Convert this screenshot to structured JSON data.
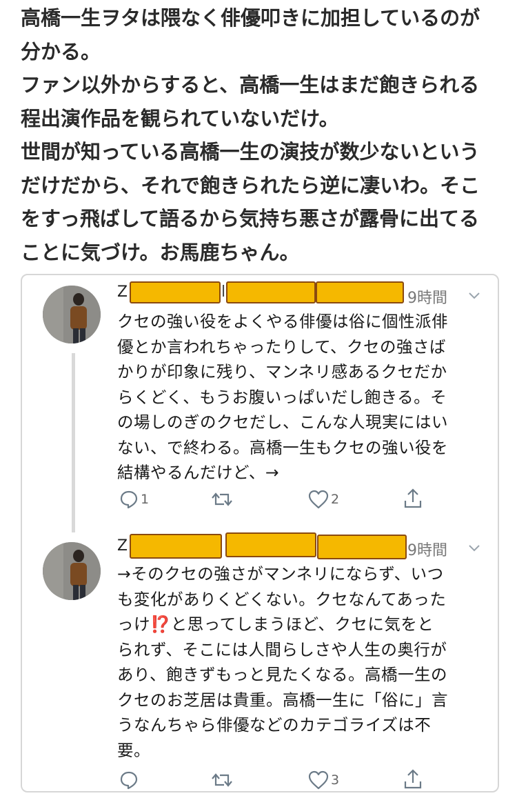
{
  "header": {
    "lines": [
      "高橋一生ヲタは隈なく俳優叩きに加担しているのが",
      "分かる。",
      "ファン以外からすると、高橋一生はまだ飽きられる",
      "程出演作品を観られていないだけ。",
      "世間が知っている高橋一生の演技が数少ないという",
      "だけだから、それで飽きられたら逆に凄いわ。そこ",
      "をすっ飛ばして語るから気持ち悪さが露骨に出てる",
      "ことに気づけ。お馬鹿ちゃん。"
    ]
  },
  "tweets": [
    {
      "name_initial": "Z",
      "name_sep": "l",
      "time": "9時間",
      "body_lines": [
        "クセの強い役をよくやる俳優は俗に個性派俳",
        "優とか言われちゃったりして、クセの強さば",
        "かりが印象に残り、マンネリ感あるクセだか",
        "らくどく、もうお腹いっぱいだし飽きる。そ",
        "の場しのぎのクセだし、こんな人現実にはい",
        "ない、で終わる。高橋一生もクセの強い役を",
        "結構やるんだけど、→"
      ],
      "actions": {
        "replies": "1",
        "retweets": "",
        "likes": "2"
      }
    },
    {
      "name_initial": "Z",
      "name_sep": "",
      "time": "9時間",
      "body_lines": [
        "→そのクセの強さがマンネリにならず、いつ",
        "も変化がありくどくない。クセなんてあった",
        "っけ",
        "と思ってしまうほど、クセに気をと",
        "られず、そこには人間らしさや人生の奥行が",
        "あり、飽きずもっと見たくなる。高橋一生の",
        "クセのお芝居は貴重。高橋一生に「俗に」言",
        "うなんちゃら俳優などのカテゴライズは不",
        "要。"
      ],
      "emoji": "⁉️",
      "actions": {
        "replies": "",
        "retweets": "",
        "likes": "3"
      }
    }
  ],
  "colors": {
    "redaction": "#f5b800",
    "redaction_border": "#8a4a10",
    "icon": "#6b7a87"
  }
}
